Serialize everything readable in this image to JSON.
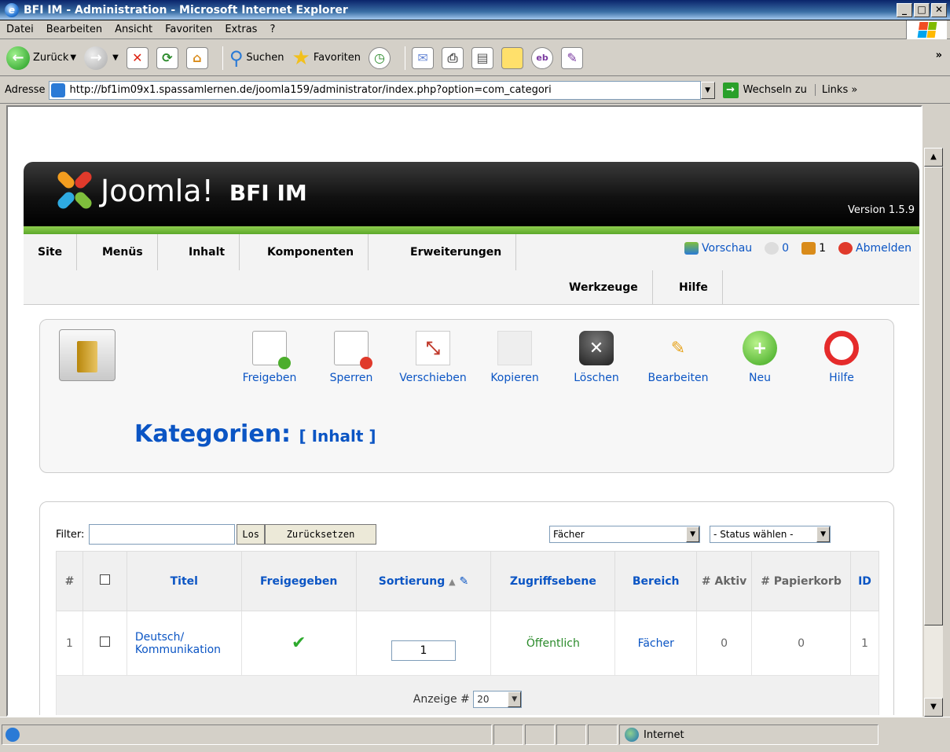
{
  "window": {
    "title": "BFI IM - Administration - Microsoft Internet Explorer",
    "min": "_",
    "max": "□",
    "close": "✕"
  },
  "menubar": {
    "items": [
      "Datei",
      "Bearbeiten",
      "Ansicht",
      "Favoriten",
      "Extras",
      "?"
    ]
  },
  "toolbar": {
    "back": "Zurück",
    "search": "Suchen",
    "favorites": "Favoriten"
  },
  "address": {
    "label": "Adresse",
    "url": "http://bf1im09x1.spassamlernen.de/joomla159/administrator/index.php?option=com_categori",
    "go": "Wechseln zu",
    "links": "Links"
  },
  "joomla": {
    "brand": "Joomla!",
    "site": "BFI IM",
    "version": "Version 1.5.9",
    "menu": [
      "Site",
      "Menüs",
      "Inhalt",
      "Komponenten",
      "Erweiterungen",
      "Werkzeuge",
      "Hilfe"
    ],
    "status": {
      "preview": "Vorschau",
      "messages": "0",
      "users": "1",
      "logout": "Abmelden"
    },
    "buttons": [
      "Freigeben",
      "Sperren",
      "Verschieben",
      "Kopieren",
      "Löschen",
      "Bearbeiten",
      "Neu",
      "Hilfe"
    ],
    "page_title": "Kategorien:",
    "page_subtitle": "[ Inhalt ]"
  },
  "filter": {
    "label": "Filter:",
    "value": "",
    "go": "Los",
    "reset": "Zurücksetzen",
    "section_select": "Fächer",
    "status_select": "- Status wählen -"
  },
  "table": {
    "headers": [
      "#",
      "",
      "Titel",
      "Freigegeben",
      "Sortierung",
      "Zugriffsebene",
      "Bereich",
      "# Aktiv",
      "# Papierkorb",
      "ID"
    ],
    "rows": [
      {
        "num": "1",
        "title": "Deutsch/ Kommunikation",
        "published": "✔",
        "order": "1",
        "access": "Öffentlich",
        "section": "Fächer",
        "active": "0",
        "trash": "0",
        "id": "1"
      }
    ],
    "footer": {
      "label": "Anzeige #",
      "value": "20"
    }
  },
  "statusbar": {
    "zone": "Internet"
  }
}
